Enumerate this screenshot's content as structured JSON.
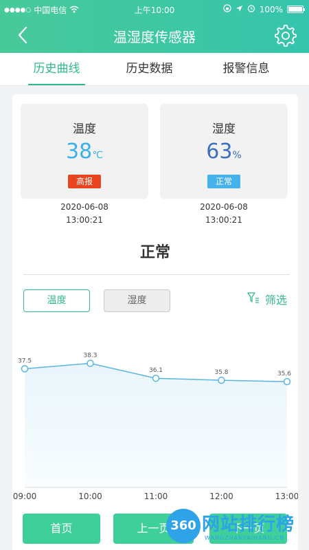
{
  "status_bar": {
    "carrier": "中国电信",
    "time": "上午10:00",
    "battery": "100%"
  },
  "nav": {
    "title": "温湿度传感器",
    "back_icon": "chevron-left-icon",
    "settings_icon": "gear-icon"
  },
  "tabs": [
    {
      "label": "历史曲线",
      "active": true
    },
    {
      "label": "历史数据",
      "active": false
    },
    {
      "label": "报警信息",
      "active": false
    }
  ],
  "cards": [
    {
      "label": "温度",
      "value": "38",
      "unit": "℃",
      "badge": "高报",
      "badge_color": "#e8441f",
      "value_color": "#3ab0e8",
      "date": "2020-06-08",
      "time": "13:00:21"
    },
    {
      "label": "湿度",
      "value": "63",
      "unit": "%",
      "badge": "正常",
      "badge_color": "#45b2ec",
      "value_color": "#3c6fbe",
      "date": "2020-06-08",
      "time": "13:00:21"
    }
  ],
  "status_text": "正常",
  "toggle": {
    "temperature": "温度",
    "humidity": "湿度"
  },
  "filter": {
    "label": "筛选",
    "icon": "filter-icon"
  },
  "chart_data": {
    "type": "area",
    "x": [
      "09:00",
      "10:00",
      "11:00",
      "12:00",
      "13:00"
    ],
    "values": [
      37.5,
      38.3,
      36.1,
      35.8,
      35.6
    ],
    "data_labels": [
      "37.5",
      "38.3",
      "36.1",
      "35.8",
      "35.6"
    ],
    "color": "#5ab4e0",
    "fill": "#eaf6fc",
    "title": "",
    "xlabel": "",
    "ylabel": ""
  },
  "pager": {
    "first": "首页",
    "prev": "上一页",
    "next": "下一页"
  },
  "watermark": {
    "badge": "360",
    "text": "网站排行榜",
    "sub": "WANGZHANPAIHANG.CN"
  }
}
